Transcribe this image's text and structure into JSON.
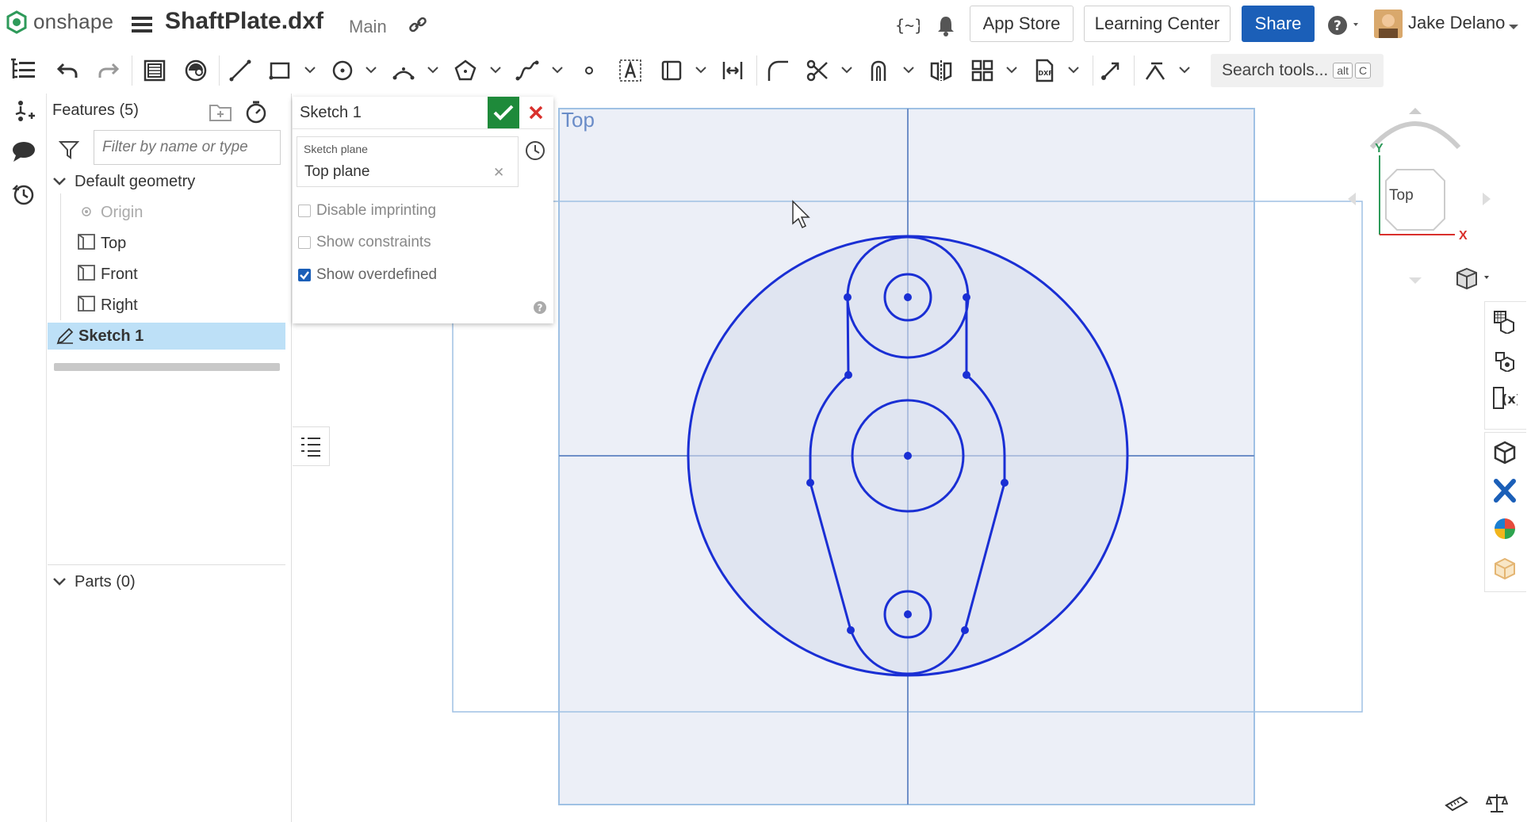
{
  "app": {
    "brand": "onshape",
    "document_title": "ShaftPlate.dxf",
    "branch": "Main"
  },
  "header": {
    "app_store_label": "App Store",
    "learning_center_label": "Learning Center",
    "share_label": "Share",
    "user_name": "Jake Delano"
  },
  "toolbar": {
    "search_placeholder": "Search tools...",
    "search_shortcut_mod": "alt",
    "search_shortcut_key": "C"
  },
  "features_panel": {
    "title": "Features (5)",
    "filter_placeholder": "Filter by name or type",
    "default_geometry_label": "Default geometry",
    "items": [
      {
        "label": "Origin"
      },
      {
        "label": "Top"
      },
      {
        "label": "Front"
      },
      {
        "label": "Right"
      }
    ],
    "selected_feature": "Sketch 1",
    "parts_label": "Parts (0)"
  },
  "sketch_dialog": {
    "title": "Sketch 1",
    "sketch_plane_label": "Sketch plane",
    "sketch_plane_value": "Top plane",
    "options": [
      {
        "label": "Disable imprinting",
        "checked": false
      },
      {
        "label": "Show constraints",
        "checked": false
      },
      {
        "label": "Show overdefined",
        "checked": true
      }
    ]
  },
  "viewport": {
    "view_label": "Top",
    "viewcube_face": "Top",
    "axis_y": "Y",
    "axis_x": "X"
  },
  "colors": {
    "brand_green": "#2e9a5a",
    "share_blue": "#1b5fb8",
    "sketch_blue": "#1a2fd4",
    "plane_fill": "#eceff7",
    "selected_row": "#bde0f7",
    "accept_green": "#1e8a3a",
    "cancel_red": "#d9302c"
  }
}
